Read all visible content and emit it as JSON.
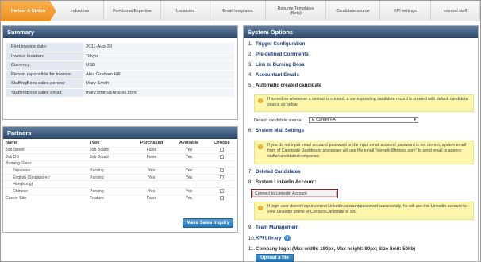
{
  "tabs": [
    "Partner & Option",
    "Industries",
    "Functional Expertise",
    "Locations",
    "Email templates",
    "Resume Templates\n(Beta)",
    "Candidate source",
    "KPI settings",
    "Internal staff"
  ],
  "summary": {
    "title": "Summary",
    "rows": [
      {
        "label": "First invoice date:",
        "value": "2011-Aug-30"
      },
      {
        "label": "Invoice location:",
        "value": "Tokyo"
      },
      {
        "label": "Currency:",
        "value": "USD"
      },
      {
        "label": "Person reponsible for invoice:",
        "value": "Alex Graham Hill"
      },
      {
        "label": "StaffingBoss sales person:",
        "value": "Mary Smith"
      },
      {
        "label": "StaffingBoss sales email:",
        "value": "mary.smith@hrboss.com"
      }
    ]
  },
  "partners": {
    "title": "Partners",
    "headers": [
      "Name",
      "Type",
      "Purchased",
      "Available",
      "Choose"
    ],
    "rows": [
      {
        "name": "Job Street",
        "type": "Job Board",
        "purchased": "False",
        "available": "Yes",
        "indent": false
      },
      {
        "name": "Job DB",
        "type": "Job Board",
        "purchased": "False",
        "available": "Yes",
        "indent": false
      },
      {
        "name": "Burning Glass",
        "type": "",
        "purchased": "",
        "available": "",
        "indent": false
      },
      {
        "name": "Japanese",
        "type": "Parsing",
        "purchased": "Yes",
        "available": "Yes",
        "indent": true
      },
      {
        "name": "English (Singapore /",
        "type": "Parsing",
        "purchased": "Yes",
        "available": "Yes",
        "indent": true
      },
      {
        "name": "Hongkong)",
        "type": "",
        "purchased": "",
        "available": "",
        "indent": true
      },
      {
        "name": "Chinese",
        "type": "Parsing",
        "purchased": "Yes",
        "available": "Yes",
        "indent": true
      },
      {
        "name": "Career Site",
        "type": "Feature",
        "purchased": "False",
        "available": "Yes",
        "indent": false
      }
    ],
    "button": "Make Sales Inquiry"
  },
  "options": {
    "title": "System Options",
    "items": [
      {
        "n": "1.",
        "label": "Trigger Configuration"
      },
      {
        "n": "2.",
        "label": "Pre-defined Comments"
      },
      {
        "n": "3.",
        "label": "Link to Burning Boss"
      },
      {
        "n": "4.",
        "label": "Accountant Emails"
      },
      {
        "n": "5.",
        "label": "Automatic created candidate"
      },
      {
        "n": "6.",
        "label": "System Mail Settings"
      },
      {
        "n": "7.",
        "label": "Deleted Candidates"
      },
      {
        "n": "8.",
        "label": "System Linkedin Account:"
      },
      {
        "n": "9.",
        "label": "Team Management"
      },
      {
        "n": "10.",
        "label": "KPI Library"
      },
      {
        "n": "11.",
        "label": "Company logo: (Max width: 180px, Max height: 80px; Size limit: 50kb)"
      }
    ],
    "note_auto": "If turned on whenever a contact is created, a corresponding candidate record is created with default candidate source as below",
    "default_source_label": "Default candidate source",
    "default_source_value": "E Career   FA",
    "note_mail": "If you do not input email account/ password or the input email account/ password is not correct, system email  from  of Candidate Dashboard processes will use the email \"noreply@hrboss.com\" to send email to agency staffs/candidates/companies",
    "linkedin_button": "Connect to Linkedin Account",
    "note_linkedin": "If login user doesn't input correct Linkedin account/password successfully, he will use this Linkedin account to view Linkedin profile of Contact/Candidate in SB.",
    "upload_button": "Upload a file"
  },
  "colors": {
    "accent": "#ef9222",
    "header": "#3b5679",
    "note": "#fbf6a9",
    "button": "#2f84c6"
  }
}
